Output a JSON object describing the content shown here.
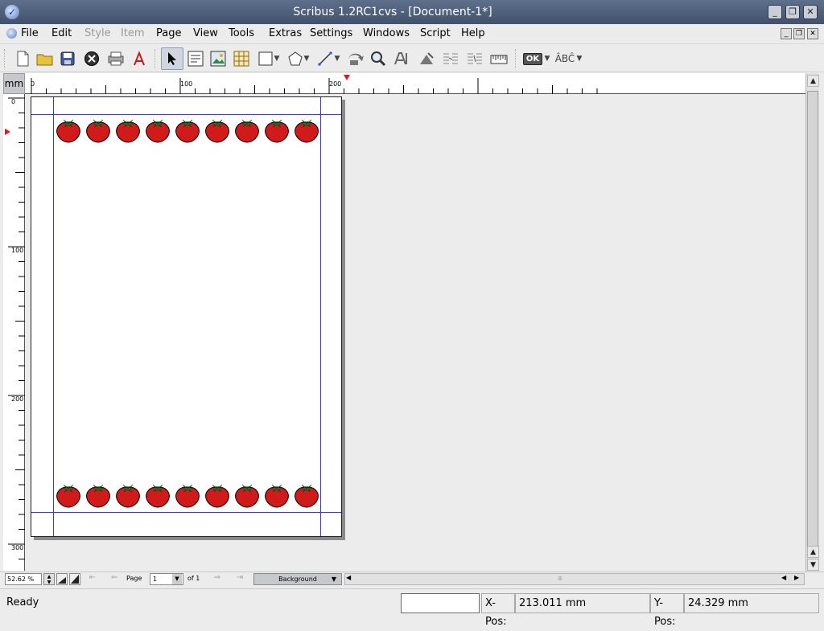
{
  "window": {
    "title": "Scribus 1.2RC1cvs - [Document-1*]"
  },
  "menubar": {
    "items": [
      {
        "label": "File",
        "enabled": true
      },
      {
        "label": "Edit",
        "enabled": true
      },
      {
        "label": "Style",
        "enabled": false
      },
      {
        "label": "Item",
        "enabled": false
      },
      {
        "label": "Page",
        "enabled": true
      },
      {
        "label": "View",
        "enabled": true
      },
      {
        "label": "Tools",
        "enabled": true
      },
      {
        "label": "Extras",
        "enabled": true
      },
      {
        "label": "Settings",
        "enabled": true
      },
      {
        "label": "Windows",
        "enabled": true
      },
      {
        "label": "Script",
        "enabled": true
      },
      {
        "label": "Help",
        "enabled": true
      }
    ]
  },
  "toolbar": {
    "icons": [
      "new-document-icon",
      "open-folder-icon",
      "save-icon",
      "close-icon",
      "print-icon",
      "pdf-icon",
      "select-arrow-icon",
      "text-frame-icon",
      "image-frame-icon",
      "table-icon",
      "shape-icon",
      "polygon-icon",
      "line-icon",
      "rotate-icon",
      "zoom-icon",
      "edit-contents-icon",
      "edit-text-icon",
      "link-frames-icon",
      "unlink-frames-icon",
      "measure-icon",
      "preflight-icon",
      "spell-check-icon"
    ],
    "ok_label": "OK",
    "spell_label": "ÂBĈ"
  },
  "ruler": {
    "unit": "mm",
    "h_labels": [
      "0",
      "100",
      "200"
    ],
    "v_labels": [
      "0",
      "100",
      "200",
      "300"
    ]
  },
  "document": {
    "top_row_count": 9,
    "bottom_row_count": 9,
    "colors": {
      "guide": "#3b3bd6",
      "berry": "#d11a1a",
      "leaf": "#1e8a2a"
    }
  },
  "navbar": {
    "zoom": "52.62 %",
    "page_label": "Page",
    "page_value": "1",
    "of_label": "of 1",
    "layer": "Background"
  },
  "statusbar": {
    "status": "Ready",
    "xpos_label": "X-Pos:",
    "xpos_value": "213.011 mm",
    "ypos_label": "Y-Pos:",
    "ypos_value": "24.329 mm"
  }
}
